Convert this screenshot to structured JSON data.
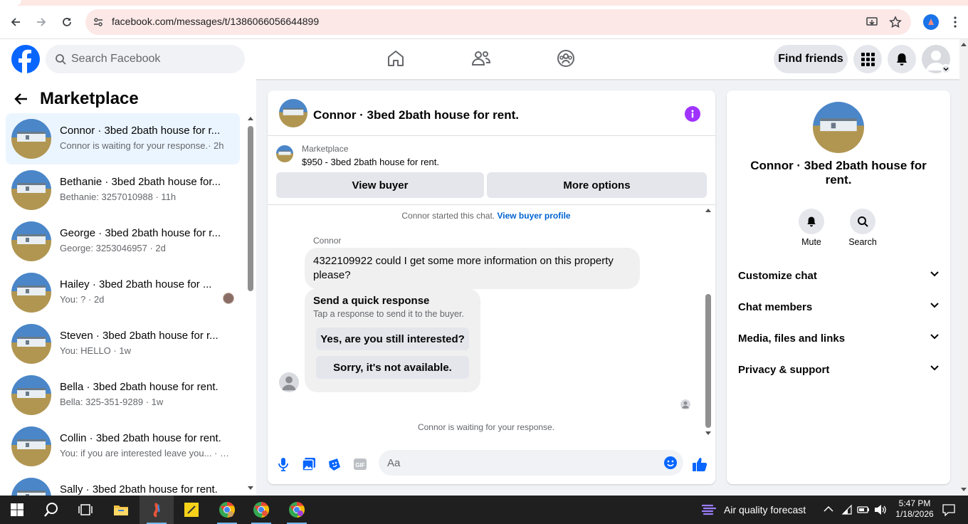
{
  "browser": {
    "url": "facebook.com/messages/t/1386066056644899"
  },
  "header": {
    "search_placeholder": "Search Facebook",
    "find_friends": "Find friends"
  },
  "sidebar": {
    "title": "Marketplace",
    "conversations": [
      {
        "title": "Connor · 3bed 2bath house for r...",
        "subtitle": "Connor is waiting for your response.· 2h",
        "active": true
      },
      {
        "title": "Bethanie · 3bed 2bath house for...",
        "subtitle": "Bethanie: 3257010988 · 11h"
      },
      {
        "title": "George · 3bed 2bath house for r...",
        "subtitle": "George: 3253046957 · 2d"
      },
      {
        "title": "Hailey · 3bed 2bath house for ...",
        "subtitle": "You: ? · 2d"
      },
      {
        "title": "Steven · 3bed 2bath house for r...",
        "subtitle": "You: HELLO · 1w"
      },
      {
        "title": "Bella · 3bed 2bath house for rent.",
        "subtitle": "Bella: 325-351-9289 · 1w"
      },
      {
        "title": "Collin · 3bed 2bath house for rent.",
        "subtitle": "You: if you are interested leave you... · 1w"
      },
      {
        "title": "Sally · 3bed 2bath house for rent.",
        "subtitle": ""
      }
    ]
  },
  "chat": {
    "title": "Connor · 3bed 2bath house for rent.",
    "listing_source": "Marketplace",
    "listing_price_title": "$950 - 3bed 2bath house for rent.",
    "view_buyer": "View buyer",
    "more_options": "More options",
    "started_text": "Connor started this chat.",
    "buyer_profile_link": "View buyer profile",
    "sender_name": "Connor",
    "message": "4322109922 could I get some more information on this property please?",
    "quick_title": "Send a quick response",
    "quick_sub": "Tap a response to send it to the buyer.",
    "quick_options": [
      "Yes, are you still interested?",
      "Sorry, it's not available."
    ],
    "waiting_text": "Connor is waiting for your response.",
    "composer_placeholder": "Aa"
  },
  "details": {
    "name": "Connor · 3bed 2bath house for rent.",
    "mute": "Mute",
    "search": "Search",
    "sections": [
      "Customize chat",
      "Chat members",
      "Media, files and links",
      "Privacy & support"
    ]
  },
  "taskbar": {
    "weather": "Air quality forecast",
    "time": "5:47 PM",
    "date": "1/18/2026"
  },
  "colors": {
    "facebook_blue": "#0866ff",
    "info_purple": "#a033ff",
    "active_bg": "#ebf5ff"
  }
}
